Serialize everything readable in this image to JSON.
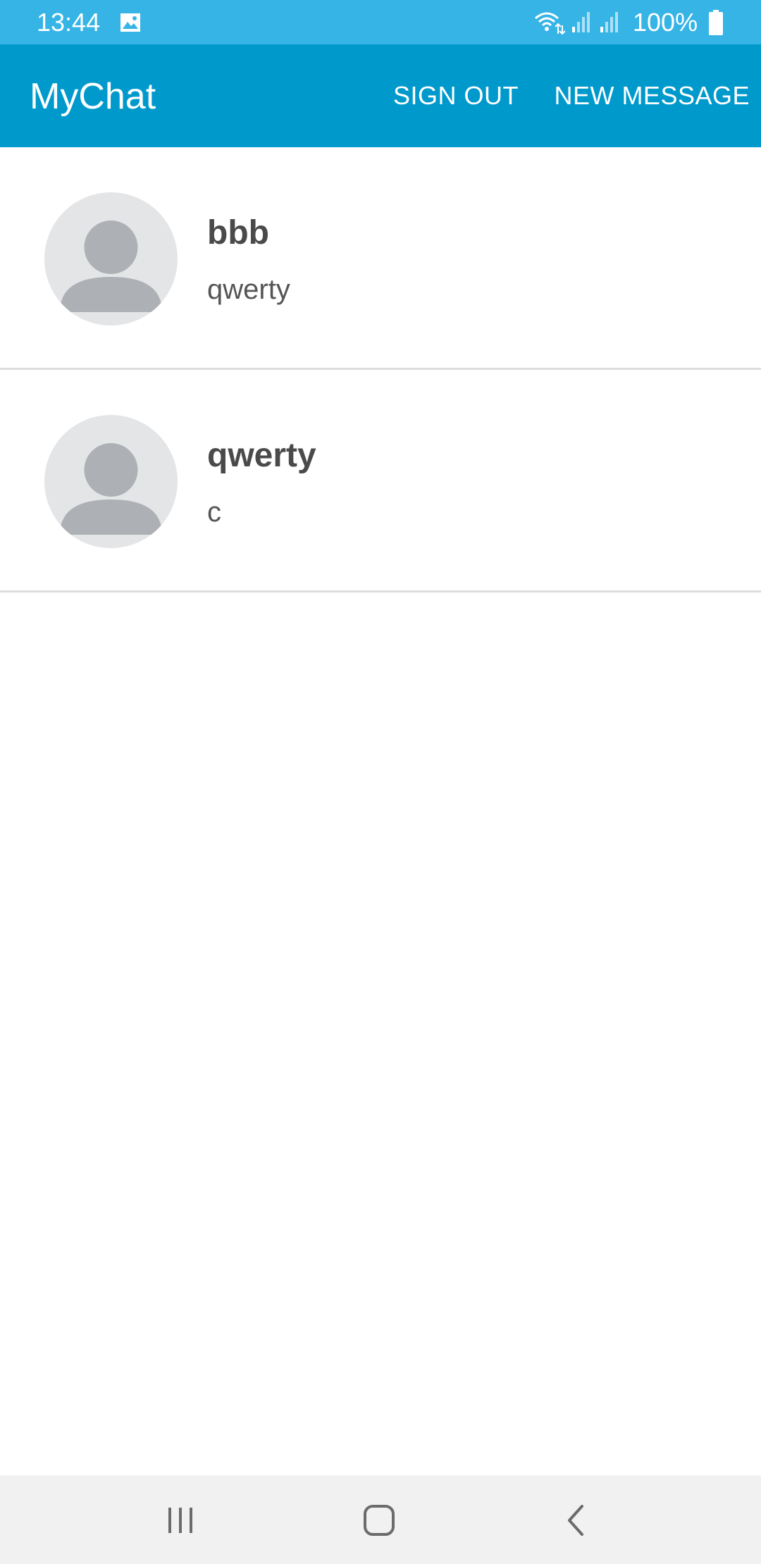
{
  "status_bar": {
    "time": "13:44",
    "battery": "100%",
    "icons": [
      "gallery-icon",
      "wifi-icon",
      "signal-icon",
      "signal-icon",
      "battery-icon"
    ],
    "color": "#36b4e6"
  },
  "app_bar": {
    "title": "MyChat",
    "sign_out_label": "SIGN OUT",
    "new_message_label": "NEW MESSAGE",
    "color": "#0099cc"
  },
  "chats": [
    {
      "name": "bbb",
      "preview": "qwerty",
      "avatar_icon": "default-avatar-icon"
    },
    {
      "name": "qwerty",
      "preview": "c",
      "avatar_icon": "default-avatar-icon"
    }
  ],
  "nav_bar": {
    "icons": [
      "recents-icon",
      "home-icon",
      "back-icon"
    ]
  }
}
